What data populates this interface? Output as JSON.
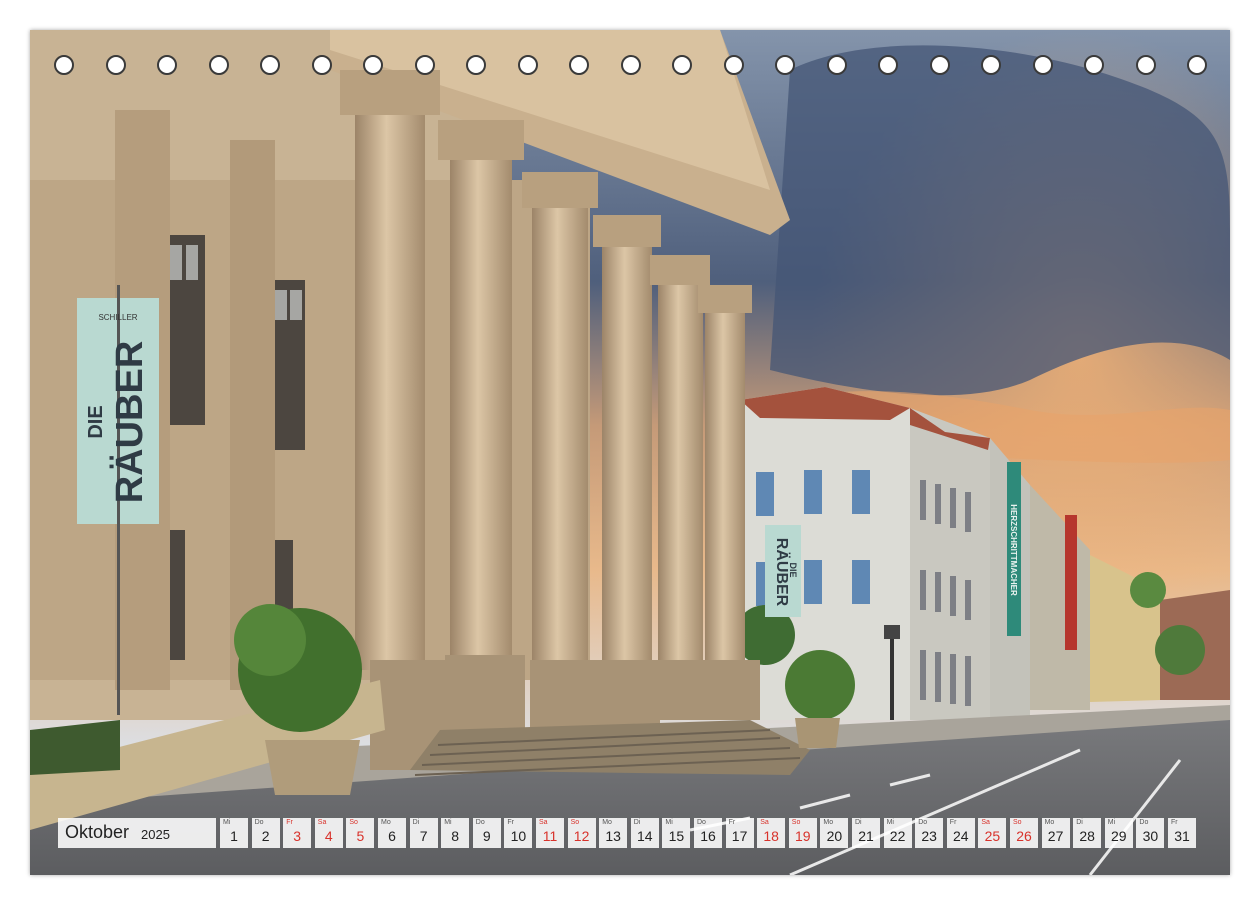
{
  "calendar": {
    "month": "Oktober",
    "year": "2025",
    "weekend_color": "#d8322b",
    "days": [
      {
        "wd": "Mi",
        "d": "1",
        "weekend": false
      },
      {
        "wd": "Do",
        "d": "2",
        "weekend": false
      },
      {
        "wd": "Fr",
        "d": "3",
        "weekend": true
      },
      {
        "wd": "Sa",
        "d": "4",
        "weekend": true
      },
      {
        "wd": "So",
        "d": "5",
        "weekend": true
      },
      {
        "wd": "Mo",
        "d": "6",
        "weekend": false
      },
      {
        "wd": "Di",
        "d": "7",
        "weekend": false
      },
      {
        "wd": "Mi",
        "d": "8",
        "weekend": false
      },
      {
        "wd": "Do",
        "d": "9",
        "weekend": false
      },
      {
        "wd": "Fr",
        "d": "10",
        "weekend": false
      },
      {
        "wd": "Sa",
        "d": "11",
        "weekend": true
      },
      {
        "wd": "So",
        "d": "12",
        "weekend": true
      },
      {
        "wd": "Mo",
        "d": "13",
        "weekend": false
      },
      {
        "wd": "Di",
        "d": "14",
        "weekend": false
      },
      {
        "wd": "Mi",
        "d": "15",
        "weekend": false
      },
      {
        "wd": "Do",
        "d": "16",
        "weekend": false
      },
      {
        "wd": "Fr",
        "d": "17",
        "weekend": false
      },
      {
        "wd": "Sa",
        "d": "18",
        "weekend": true
      },
      {
        "wd": "So",
        "d": "19",
        "weekend": true
      },
      {
        "wd": "Mo",
        "d": "20",
        "weekend": false
      },
      {
        "wd": "Di",
        "d": "21",
        "weekend": false
      },
      {
        "wd": "Mi",
        "d": "22",
        "weekend": false
      },
      {
        "wd": "Do",
        "d": "23",
        "weekend": false
      },
      {
        "wd": "Fr",
        "d": "24",
        "weekend": false
      },
      {
        "wd": "Sa",
        "d": "25",
        "weekend": true
      },
      {
        "wd": "So",
        "d": "26",
        "weekend": true
      },
      {
        "wd": "Mo",
        "d": "27",
        "weekend": false
      },
      {
        "wd": "Di",
        "d": "28",
        "weekend": false
      },
      {
        "wd": "Mi",
        "d": "29",
        "weekend": false
      },
      {
        "wd": "Do",
        "d": "30",
        "weekend": false
      },
      {
        "wd": "Fr",
        "d": "31",
        "weekend": false
      }
    ]
  },
  "photo": {
    "banner_left": {
      "small": "SCHILLER",
      "line1": "DIE",
      "line2": "RÄUBER"
    },
    "banner_mid": {
      "line1": "DIE",
      "line2": "RÄUBER"
    },
    "banner_right": "HERZSCHRITTMACHER",
    "sky_color": "#6f7f96",
    "stone_color": "#cdb79a"
  }
}
